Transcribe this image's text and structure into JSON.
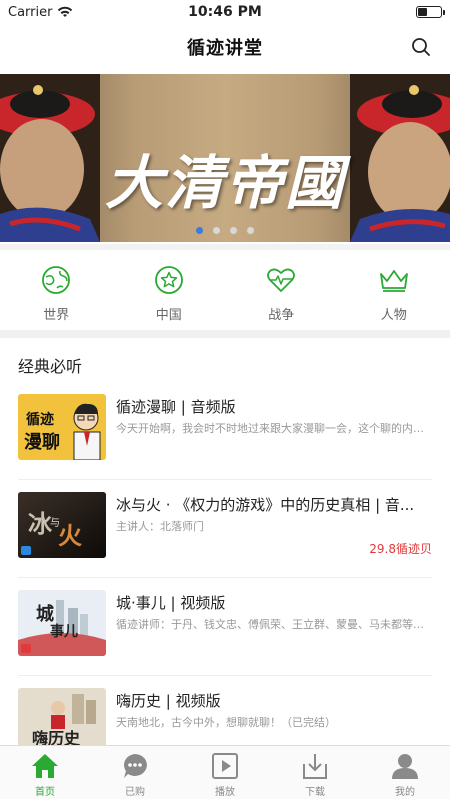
{
  "status_bar": {
    "carrier": "Carrier",
    "time": "10:46 PM"
  },
  "nav": {
    "title": "循迹讲堂",
    "search_icon": "search-icon"
  },
  "banner": {
    "title": "大清帝國",
    "dots": 4,
    "active_dot": 0
  },
  "categories": [
    {
      "label": "世界",
      "icon": "globe-icon"
    },
    {
      "label": "中国",
      "icon": "star-badge-icon"
    },
    {
      "label": "战争",
      "icon": "heart-pulse-icon"
    },
    {
      "label": "人物",
      "icon": "crown-icon"
    }
  ],
  "section": {
    "title": "经典必听"
  },
  "items": [
    {
      "title": "循迹漫聊 | 音频版",
      "desc": "今天开始啊，我会时不时地过来跟大家漫聊一会，这个聊的内容...",
      "price": "",
      "thumb_text": "循迹漫聊"
    },
    {
      "title": "冰与火 · 《权力的游戏》中的历史真相 | 音...",
      "desc": "主讲人：北落师门",
      "price": "29.8循迹贝",
      "thumb_text": "冰与火"
    },
    {
      "title": "城·事儿 | 视频版",
      "desc": "循迹讲师：于丹、钱文忠、傅佩荣、王立群、蒙曼、马未都等名...",
      "price": "",
      "thumb_text": "城事儿"
    },
    {
      "title": "嗨历史 | 视频版",
      "desc": "天南地北，古今中外，想聊就聊！（已完结）",
      "price": "",
      "thumb_text": "嗨历史"
    }
  ],
  "tabs": [
    {
      "label": "首页",
      "icon": "home-icon",
      "active": true
    },
    {
      "label": "已购",
      "icon": "chat-bubble-icon",
      "active": false
    },
    {
      "label": "播放",
      "icon": "play-icon",
      "active": false
    },
    {
      "label": "下载",
      "icon": "download-icon",
      "active": false
    },
    {
      "label": "我的",
      "icon": "user-icon",
      "active": false
    }
  ],
  "colors": {
    "accent": "#2aaa33",
    "price": "#e03a3a",
    "dot_active": "#3a7ae6"
  }
}
